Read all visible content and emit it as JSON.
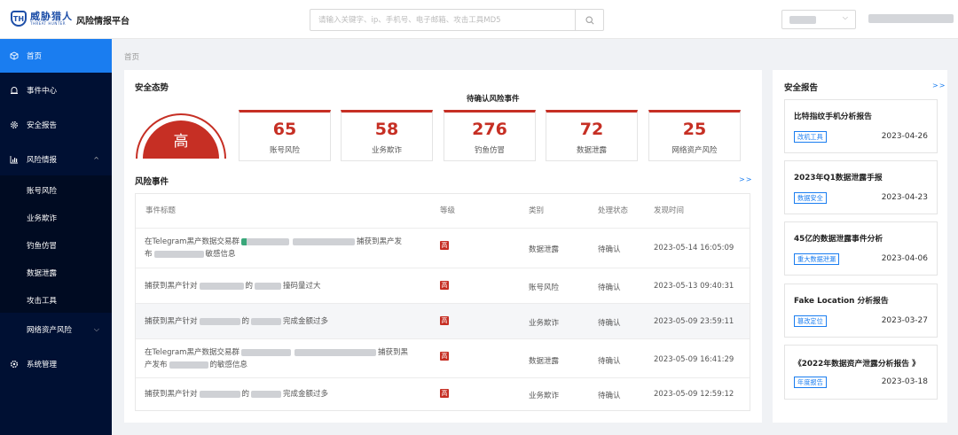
{
  "app": {
    "logo_cn": "威胁猎人",
    "logo_en": "THREAT HUNTER",
    "logo_mark": "TH",
    "platform_title": "风险情报平台"
  },
  "search": {
    "placeholder": "请输入关键字、ip、手机号、电子邮箱、攻击工具MD5",
    "icon": "search-icon"
  },
  "sidebar": {
    "items": [
      {
        "label": "首页",
        "icon": "cube-icon"
      },
      {
        "label": "事件中心",
        "icon": "alert-icon"
      },
      {
        "label": "安全报告",
        "icon": "gear-icon"
      },
      {
        "label": "风险情报",
        "icon": "bar-chart-icon"
      },
      {
        "label": "网络资产风险",
        "icon": "none"
      },
      {
        "label": "系统管理",
        "icon": "settings-icon"
      }
    ],
    "sub_items": [
      "账号风险",
      "业务欺诈",
      "钓鱼仿冒",
      "数据泄露",
      "攻击工具"
    ]
  },
  "breadcrumb": "首页",
  "security_posture": {
    "title": "安全态势",
    "level": "高",
    "pending_title": "待确认风险事件",
    "stats": [
      {
        "value": "65",
        "label": "账号风险"
      },
      {
        "value": "58",
        "label": "业务欺诈"
      },
      {
        "value": "276",
        "label": "钓鱼仿冒"
      },
      {
        "value": "72",
        "label": "数据泄露"
      },
      {
        "value": "25",
        "label": "网络资产风险"
      }
    ]
  },
  "risk_events": {
    "title": "风险事件",
    "more": ">>",
    "columns": [
      "事件标题",
      "等级",
      "类别",
      "处理状态",
      "发现时间"
    ],
    "rows": [
      {
        "title_a": "在Telegram黑产数据交易群",
        "title_b": "捕获到黑产发",
        "title_c": "布",
        "title_d": "敏感信息",
        "level": "高",
        "category": "数据泄露",
        "status": "待确认",
        "time": "2023-05-14 16:05:09"
      },
      {
        "title_a": "捕获到黑产针对",
        "title_b": "的",
        "title_c": "撞码量过大",
        "level": "高",
        "category": "账号风险",
        "status": "待确认",
        "time": "2023-05-13 09:40:31"
      },
      {
        "title_a": "捕获到黑产针对",
        "title_b": "的",
        "title_c": "完成金额过多",
        "level": "高",
        "category": "业务欺诈",
        "status": "待确认",
        "time": "2023-05-09 23:59:11"
      },
      {
        "title_a": "在Telegram黑产数据交易群",
        "title_b": "捕获到黑",
        "title_c": "产发布",
        "title_d": "的敏感信息",
        "level": "高",
        "category": "数据泄露",
        "status": "待确认",
        "time": "2023-05-09 16:41:29"
      },
      {
        "title_a": "捕获到黑产针对",
        "title_b": "的",
        "title_c": "完成金额过多",
        "level": "高",
        "category": "业务欺诈",
        "status": "待确认",
        "time": "2023-05-09 12:59:12"
      }
    ]
  },
  "reports": {
    "title": "安全报告",
    "more": ">>",
    "items": [
      {
        "title": "比特指纹手机分析报告",
        "tag": "改机工具",
        "date": "2023-04-26"
      },
      {
        "title": "2023年Q1数据泄露手报",
        "tag": "数据安全",
        "date": "2023-04-23"
      },
      {
        "title": "45亿的数据泄露事件分析",
        "tag": "重大数据泄漏",
        "date": "2023-04-06"
      },
      {
        "title": "Fake Location 分析报告",
        "tag": "篡改定位",
        "date": "2023-03-27"
      },
      {
        "title": "《2022年数据资产泄露分析报告 》",
        "tag": "年度报告",
        "date": "2023-03-18"
      }
    ]
  },
  "colors": {
    "primary": "#1a7df0",
    "danger": "#c62f24",
    "sidebar_bg": "#001033",
    "brand": "#1e4fa8"
  }
}
